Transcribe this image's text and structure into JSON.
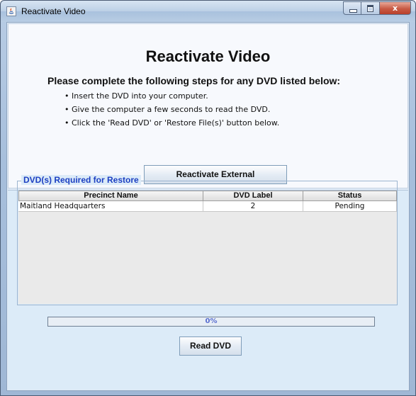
{
  "window": {
    "title": "Reactivate Video",
    "buttons": {
      "close_label": "x"
    }
  },
  "main": {
    "heading": "Reactivate Video",
    "instructions": "Please complete the following steps for any DVD listed below:",
    "steps": [
      "Insert the DVD into your computer.",
      "Give the computer a few seconds to read the DVD.",
      "Click the 'Read DVD' or 'Restore File(s)' button below."
    ],
    "reactivate_external_label": "Reactivate External"
  },
  "restore": {
    "group_title": "DVD(s) Required for Restore",
    "columns": [
      "Precinct Name",
      "DVD Label",
      "Status"
    ],
    "rows": [
      {
        "precinct": "Maitland Headquarters",
        "dvd_label": "2",
        "status": "Pending"
      }
    ],
    "progress_text": "0%",
    "progress_value": 0,
    "read_dvd_label": "Read DVD"
  },
  "colors": {
    "legend_text": "#1c3fc2",
    "panel_background": "#dcebf8",
    "close_button": "#c85a44"
  },
  "icons": [
    "java-app-icon",
    "minimize-icon",
    "maximize-icon",
    "close-icon"
  ]
}
